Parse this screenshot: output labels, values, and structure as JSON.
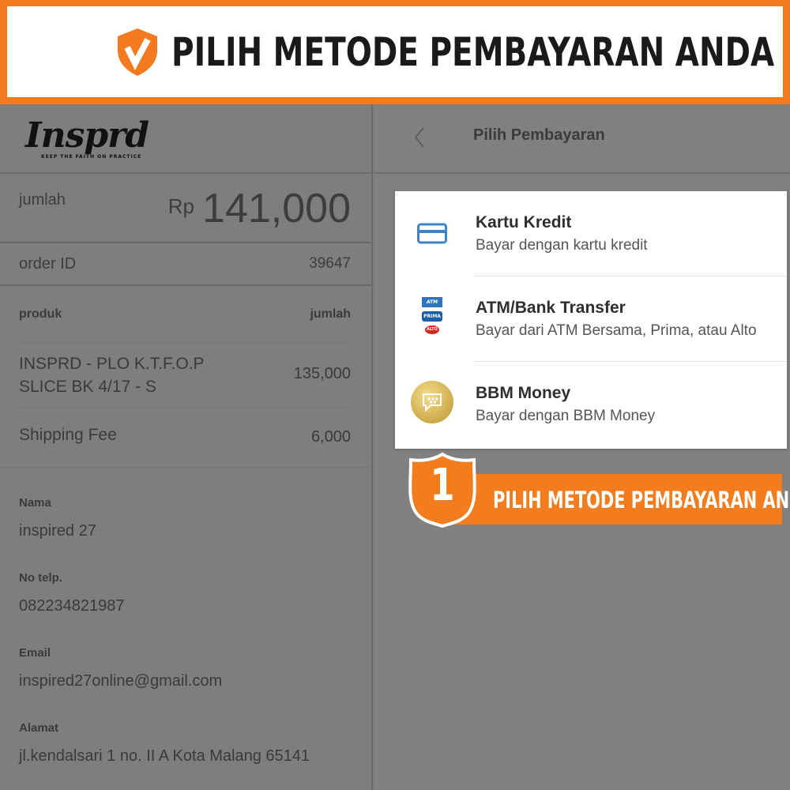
{
  "banner": {
    "title": "PILIH METODE PEMBAYARAN ANDA",
    "icon": "check-shield-icon",
    "accent_color": "#f47a1f"
  },
  "order": {
    "logo_text": "Insprd",
    "logo_tagline": "KEEP THE FAITH ON PRACTICE",
    "amount_label": "jumlah",
    "currency": "Rp",
    "amount": "141,000",
    "order_id_label": "order ID",
    "order_id": "39647",
    "table_headers": [
      "produk",
      "jumlah"
    ],
    "items": [
      {
        "name": "INSPRD - PLO K.T.F.O.P SLICE BK 4/17 - S",
        "price": "135,000"
      },
      {
        "name": "Shipping Fee",
        "price": "6,000"
      }
    ],
    "customer": [
      {
        "label": "Nama",
        "value": "inspired 27"
      },
      {
        "label": "No telp.",
        "value": "082234821987"
      },
      {
        "label": "Email",
        "value": "inspired27online@gmail.com"
      },
      {
        "label": "Alamat",
        "value": "jl.kendalsari 1 no. II A Kota Malang 65141"
      }
    ]
  },
  "payment": {
    "header_title": "Pilih Pembayaran",
    "methods": [
      {
        "title": "Kartu Kredit",
        "desc": "Bayar dengan kartu kredit",
        "icon": "credit-card-icon"
      },
      {
        "title": "ATM/Bank Transfer",
        "desc": "Bayar dari ATM Bersama, Prima, atau Alto",
        "icon": "bank-network-icon"
      },
      {
        "title": "BBM Money",
        "desc": "Bayar dengan BBM Money",
        "icon": "bbm-icon"
      }
    ],
    "bank_logos": [
      "ATM",
      "PRIMA",
      "ALTO"
    ]
  },
  "callout": {
    "number": "1",
    "text": "PILIH METODE PEMBAYARAN ANDA"
  }
}
